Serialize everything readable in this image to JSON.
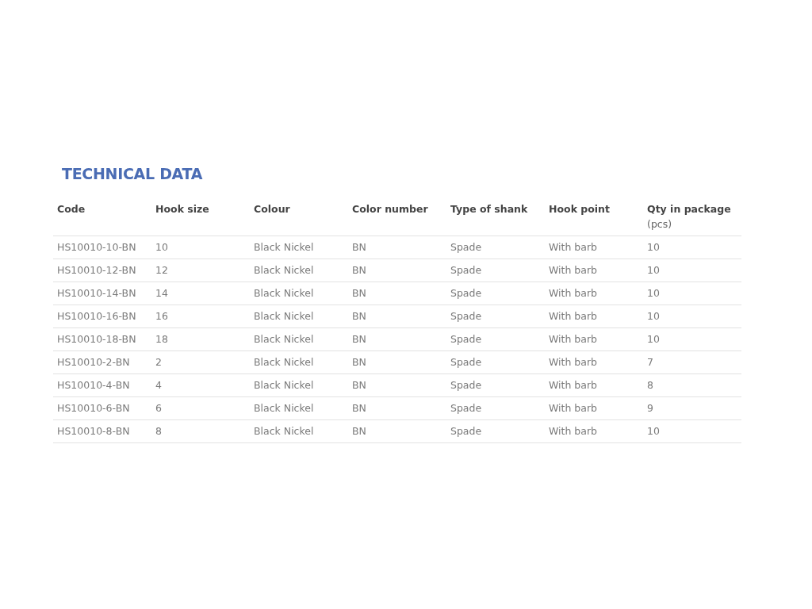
{
  "title": "TECHNICAL DATA",
  "table": {
    "columns": [
      {
        "label": "Code"
      },
      {
        "label": "Hook size"
      },
      {
        "label": "Colour"
      },
      {
        "label": "Color number"
      },
      {
        "label": "Type of shank"
      },
      {
        "label": "Hook point"
      },
      {
        "label": "Qty in package",
        "unit": "(pcs)"
      }
    ],
    "rows": [
      [
        "HS10010-10-BN",
        "10",
        "Black Nickel",
        "BN",
        "Spade",
        "With barb",
        "10"
      ],
      [
        "HS10010-12-BN",
        "12",
        "Black Nickel",
        "BN",
        "Spade",
        "With barb",
        "10"
      ],
      [
        "HS10010-14-BN",
        "14",
        "Black Nickel",
        "BN",
        "Spade",
        "With barb",
        "10"
      ],
      [
        "HS10010-16-BN",
        "16",
        "Black Nickel",
        "BN",
        "Spade",
        "With barb",
        "10"
      ],
      [
        "HS10010-18-BN",
        "18",
        "Black Nickel",
        "BN",
        "Spade",
        "With barb",
        "10"
      ],
      [
        "HS10010-2-BN",
        "2",
        "Black Nickel",
        "BN",
        "Spade",
        "With barb",
        "7"
      ],
      [
        "HS10010-4-BN",
        "4",
        "Black Nickel",
        "BN",
        "Spade",
        "With barb",
        "8"
      ],
      [
        "HS10010-6-BN",
        "6",
        "Black Nickel",
        "BN",
        "Spade",
        "With barb",
        "9"
      ],
      [
        "HS10010-8-BN",
        "8",
        "Black Nickel",
        "BN",
        "Spade",
        "With barb",
        "10"
      ]
    ]
  }
}
